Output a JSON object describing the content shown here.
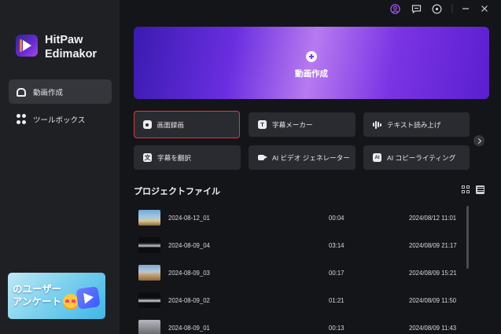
{
  "app": {
    "brand_line1": "HitPaw",
    "brand_line2": "Edimakor"
  },
  "sidebar": {
    "items": [
      {
        "label": "動画作成",
        "icon": "home-icon",
        "active": true
      },
      {
        "label": "ツールボックス",
        "icon": "toolbox-icon",
        "active": false
      }
    ],
    "promo": {
      "line1": "のユーザー",
      "line2": "アンケート"
    }
  },
  "titlebar": {
    "icons": [
      "account-icon",
      "feedback-icon",
      "settings-icon",
      "minimize-icon",
      "close-icon"
    ]
  },
  "hero": {
    "label": "動画作成",
    "icon": "plus-icon"
  },
  "tools": [
    {
      "label": "画面録画",
      "icon": "screen-record-icon",
      "selected": true
    },
    {
      "label": "字幕メーカー",
      "icon": "subtitle-icon",
      "selected": false
    },
    {
      "label": "テキスト読み上げ",
      "icon": "audio-wave-icon",
      "selected": false
    },
    {
      "label": "字幕を翻訳",
      "icon": "translate-icon",
      "selected": false
    },
    {
      "label": "AI ビデオ ジェネレーター",
      "icon": "video-camera-icon",
      "selected": false
    },
    {
      "label": "AI コピーライティング",
      "icon": "ai-icon",
      "selected": false
    }
  ],
  "projects": {
    "title": "プロジェクトファイル",
    "view_mode": "list",
    "rows": [
      {
        "name": "2024-08-12_01",
        "duration": "00:04",
        "modified": "2024/08/12 11:01"
      },
      {
        "name": "2024-08-09_04",
        "duration": "03:14",
        "modified": "2024/08/09 21:17"
      },
      {
        "name": "2024-08-09_03",
        "duration": "00:17",
        "modified": "2024/08/09 15:21"
      },
      {
        "name": "2024-08-09_02",
        "duration": "01:21",
        "modified": "2024/08/09 11:50"
      },
      {
        "name": "2024-08-09_01",
        "duration": "00:13",
        "modified": "2024/08/09 11:43"
      }
    ]
  },
  "colors": {
    "background": "#141519",
    "sidebar": "#1f2024",
    "card": "#2a2b30",
    "accent_purple": "#6a2ee0",
    "selected_border": "#e0383d"
  }
}
